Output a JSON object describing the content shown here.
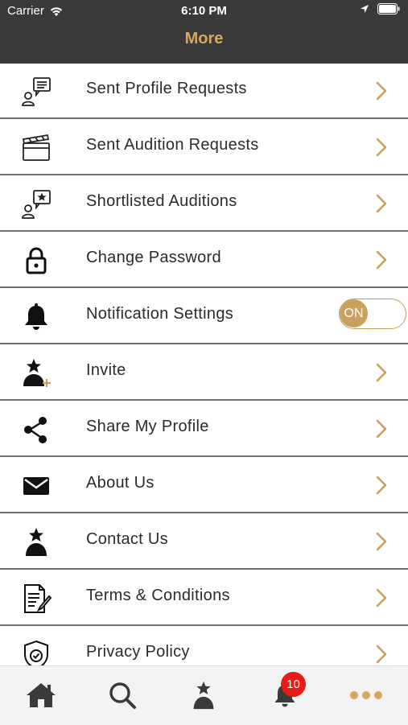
{
  "status_bar": {
    "carrier": "Carrier",
    "time": "6:10 PM"
  },
  "header": {
    "title": "More"
  },
  "menu": {
    "items": [
      {
        "label": "Sent Profile Requests",
        "icon": "profile-request-icon"
      },
      {
        "label": "Sent Audition Requests",
        "icon": "clapperboard-icon"
      },
      {
        "label": "Shortlisted Auditions",
        "icon": "shortlist-star-icon"
      },
      {
        "label": "Change Password",
        "icon": "lock-icon"
      },
      {
        "label": "Notification Settings",
        "icon": "bell-icon"
      },
      {
        "label": "Invite",
        "icon": "invite-user-icon"
      },
      {
        "label": "Share My Profile",
        "icon": "share-icon"
      },
      {
        "label": "About Us",
        "icon": "envelope-icon"
      },
      {
        "label": "Contact Us",
        "icon": "star-person-icon"
      },
      {
        "label": "Terms & Conditions",
        "icon": "document-edit-icon"
      },
      {
        "label": "Privacy Policy",
        "icon": "shield-check-icon"
      }
    ],
    "notification_toggle": "ON"
  },
  "tab_bar": {
    "tabs": [
      {
        "name": "home",
        "icon": "home-icon"
      },
      {
        "name": "search",
        "icon": "search-icon"
      },
      {
        "name": "talent",
        "icon": "star-person-icon"
      },
      {
        "name": "notifications",
        "icon": "bell-icon"
      },
      {
        "name": "more",
        "icon": "more-dots-icon"
      }
    ],
    "notification_badge": "10"
  },
  "colors": {
    "accent": "#c9a15f",
    "header_bg": "#3a3a3a",
    "badge": "#e51b16"
  }
}
